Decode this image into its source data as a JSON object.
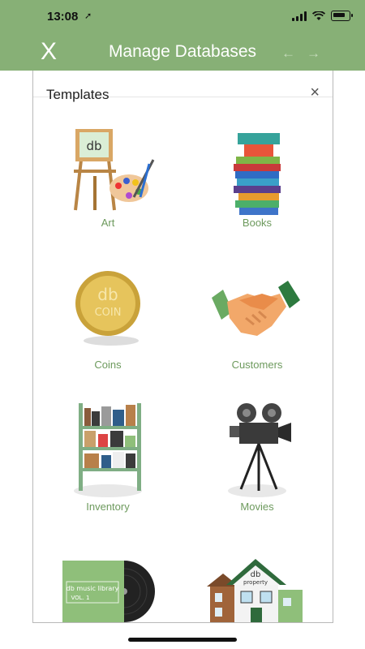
{
  "status_bar": {
    "time": "13:08",
    "location_arrow": "location-arrow-icon"
  },
  "header": {
    "close_label": "X",
    "title": "Manage Databases"
  },
  "modal": {
    "title": "Templates",
    "close_label": "×"
  },
  "templates": [
    {
      "label": "Art",
      "icon": "easel-palette-icon",
      "easel_text": "db"
    },
    {
      "label": "Books",
      "icon": "book-stack-icon"
    },
    {
      "label": "Coins",
      "icon": "coin-icon",
      "coin_text_top": "db",
      "coin_text_bottom": "COIN"
    },
    {
      "label": "Customers",
      "icon": "handshake-icon"
    },
    {
      "label": "Inventory",
      "icon": "shelves-icon"
    },
    {
      "label": "Movies",
      "icon": "movie-camera-icon"
    },
    {
      "label": "",
      "icon": "vinyl-record-icon",
      "album_title": "db music library",
      "album_vol": "VOL. 1"
    },
    {
      "label": "",
      "icon": "house-icon",
      "house_text_top": "db",
      "house_text_bottom": "property"
    }
  ],
  "colors": {
    "header_green": "#87b076",
    "label_green": "#6d9a5d"
  }
}
